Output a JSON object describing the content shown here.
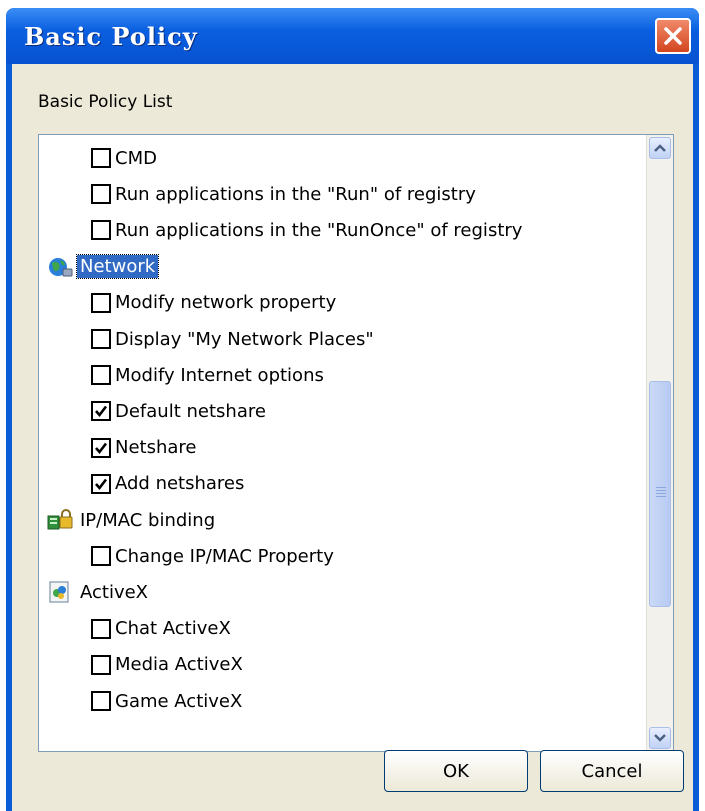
{
  "window": {
    "title": "Basic Policy"
  },
  "list_label": "Basic Policy List",
  "items": [
    {
      "label": "CMD",
      "checked": false
    },
    {
      "label": "Run applications in the \"Run\"  of registry",
      "checked": false
    },
    {
      "label": "Run applications in the \"RunOnce\" of registry",
      "checked": false
    },
    {
      "label": "Network",
      "category": true,
      "icon": "network-globe-icon",
      "selected": true
    },
    {
      "label": "Modify network property",
      "checked": false
    },
    {
      "label": "Display \"My Network Places\"",
      "checked": false
    },
    {
      "label": "Modify Internet options",
      "checked": false
    },
    {
      "label": "Default netshare",
      "checked": true
    },
    {
      "label": "Netshare",
      "checked": true
    },
    {
      "label": "Add netshares",
      "checked": true
    },
    {
      "label": "IP/MAC binding",
      "category": true,
      "icon": "ip-mac-binding-icon"
    },
    {
      "label": "Change IP/MAC Property",
      "checked": false
    },
    {
      "label": "ActiveX",
      "category": true,
      "icon": "activex-icon"
    },
    {
      "label": "Chat ActiveX",
      "checked": false
    },
    {
      "label": "Media ActiveX",
      "checked": false
    },
    {
      "label": "Game ActiveX",
      "checked": false
    }
  ],
  "buttons": {
    "ok": "OK",
    "cancel": "Cancel"
  },
  "colors": {
    "titlebar": "#0a5fe0",
    "selection": "#316ac5",
    "dialog_bg": "#ece9d8",
    "close": "#d3461e"
  }
}
